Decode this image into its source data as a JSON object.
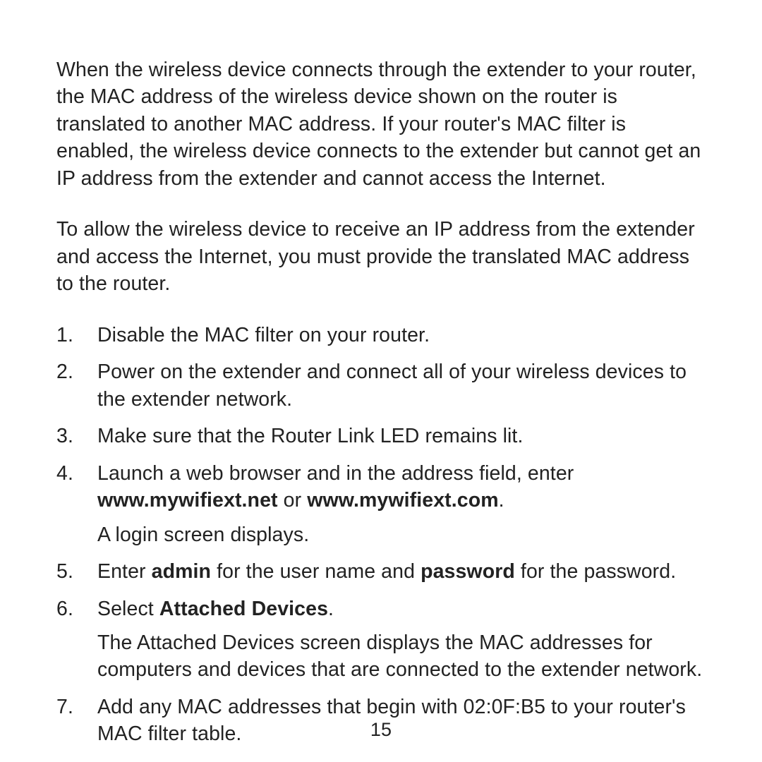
{
  "intro": {
    "p1": "When the wireless device connects through the extender to your router, the MAC address of the wireless device shown on the router is translated to another MAC address. If your router's MAC filter is enabled, the wireless device connects to the extender but cannot get an IP address from the extender and cannot access the Internet.",
    "p2": "To allow the wireless device to receive an IP address from the extender and access the Internet, you must provide the translated MAC address to the router."
  },
  "steps": {
    "s1": "Disable the MAC filter on your router.",
    "s2": "Power on the extender and connect all of your wireless devices to the extender network.",
    "s3": "Make sure that the Router Link LED remains lit.",
    "s4_pre": "Launch a web browser and in the address field, enter ",
    "s4_url1": "www.mywifiext.net",
    "s4_or": " or ",
    "s4_url2": "www.mywifiext.com",
    "s4_period": ".",
    "s4_sub": "A login screen displays.",
    "s5_pre": "Enter ",
    "s5_admin": "admin",
    "s5_mid": " for the user name and ",
    "s5_password": "password",
    "s5_post": " for the password.",
    "s6_pre": "Select ",
    "s6_bold": "Attached Devices",
    "s6_period": ".",
    "s6_sub": "The Attached Devices screen displays the MAC addresses for computers and devices that are connected to the extender network.",
    "s7": "Add any MAC addresses that begin with 02:0F:B5 to your router's MAC filter table."
  },
  "page_number": "15"
}
